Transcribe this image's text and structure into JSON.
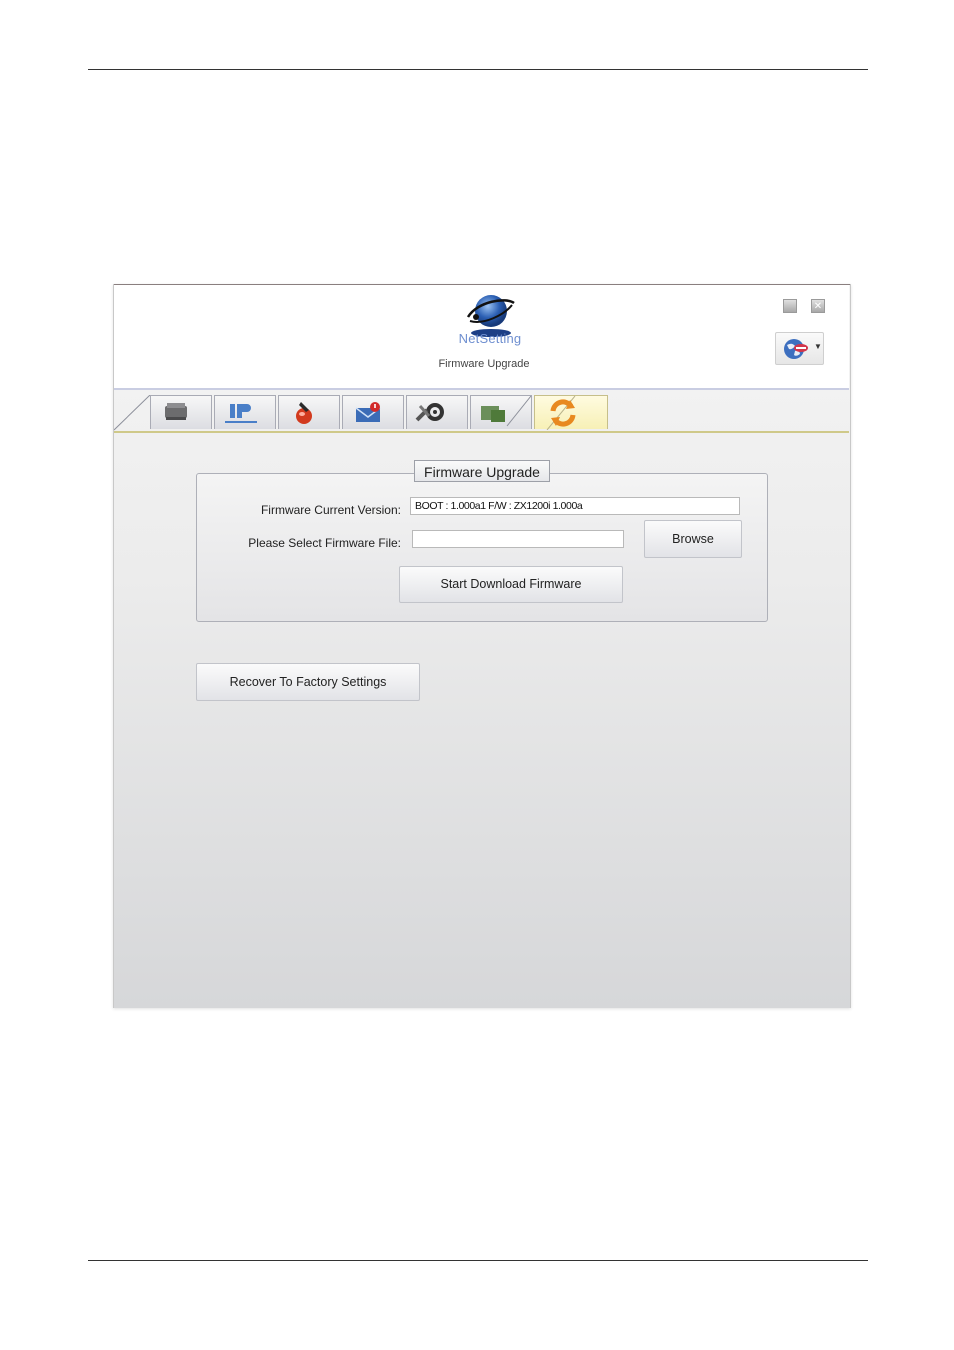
{
  "window": {
    "brand": "NetSetting",
    "subtitle": "Firmware Upgrade",
    "minimize_label": "",
    "close_label": "✕"
  },
  "tabs": [
    {
      "name": "printer",
      "icon": "printer-icon"
    },
    {
      "name": "ip-network",
      "icon": "ip-network-icon"
    },
    {
      "name": "alert",
      "icon": "alert-bell-icon"
    },
    {
      "name": "mail",
      "icon": "mail-alert-icon"
    },
    {
      "name": "configuration",
      "icon": "gear-tools-icon"
    },
    {
      "name": "keyboard",
      "icon": "printer-keyboard-icon"
    },
    {
      "name": "firmware-upgrade",
      "icon": "refresh-arrows-icon",
      "active": true
    }
  ],
  "firmware_group": {
    "title": "Firmware Upgrade",
    "current_version_label": "Firmware Current Version:",
    "current_version_value": "BOOT : 1.000a1 F/W : ZX1200i 1.000a",
    "select_file_label": "Please Select Firmware File:",
    "select_file_value": "",
    "browse_label": "Browse",
    "start_download_label": "Start Download Firmware"
  },
  "recover_label": "Recover To Factory  Settings",
  "colors": {
    "active_tab": "#f7f0b6",
    "brand_text": "#6f8fd0",
    "logo_blue": "#2b5fb3"
  }
}
